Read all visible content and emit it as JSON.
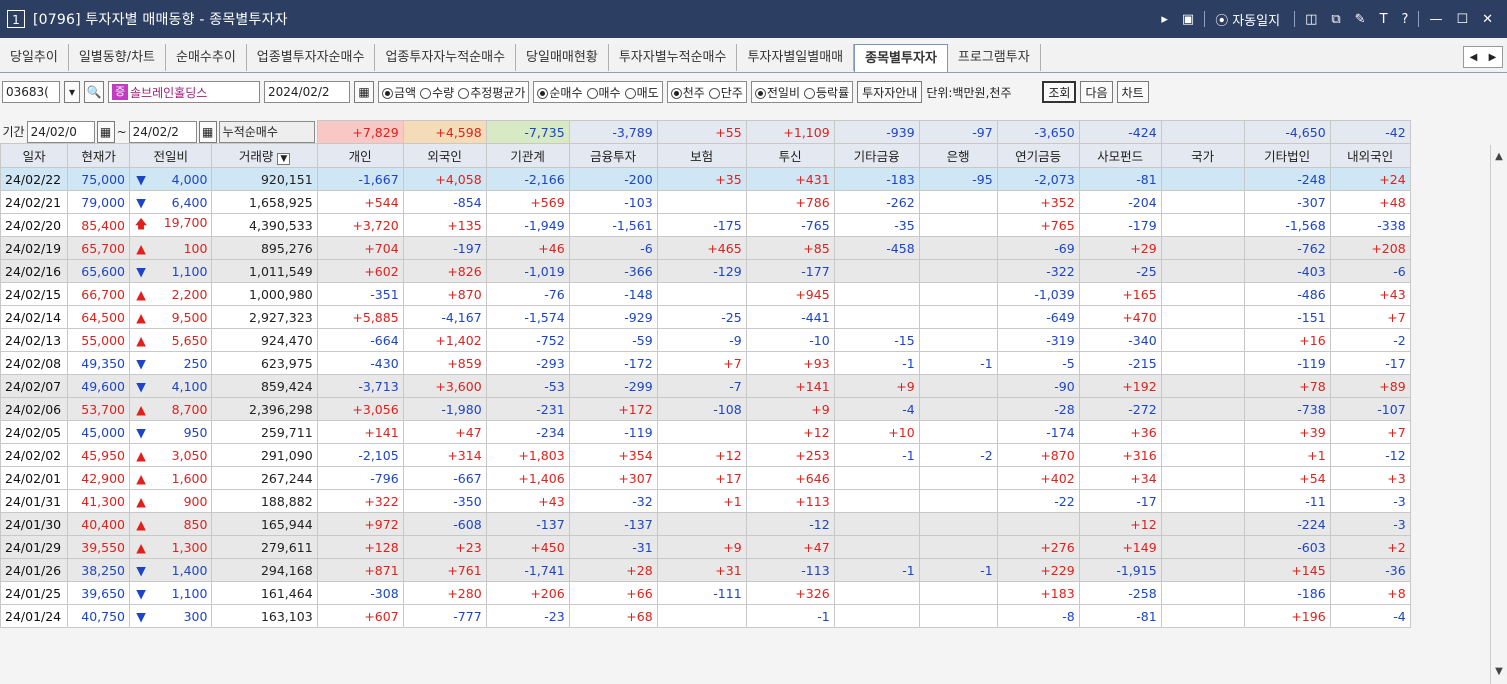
{
  "window": {
    "number": "1",
    "title": "[0796] 투자자별 매매동향 - 종목별투자자",
    "auto_label": "자동일지"
  },
  "tabs": [
    {
      "label": "당일추이",
      "active": false
    },
    {
      "label": "일별동향/차트",
      "active": false
    },
    {
      "label": "순매수추이",
      "active": false
    },
    {
      "label": "업종별투자자순매수",
      "active": false
    },
    {
      "label": "업종투자자누적순매수",
      "active": false
    },
    {
      "label": "당일매매현황",
      "active": false
    },
    {
      "label": "투자자별누적순매수",
      "active": false
    },
    {
      "label": "투자자별일별매매",
      "active": false
    },
    {
      "label": "종목별투자자",
      "active": true
    },
    {
      "label": "프로그램투자",
      "active": false
    }
  ],
  "toolbar": {
    "code": "03683(",
    "stock_badge": "증",
    "stock_name": "솔브레인홀딩스",
    "date": "2024/02/2",
    "opt_amount": "금액",
    "opt_qty": "수량",
    "opt_avg": "추정평균가",
    "opt_net": "순매수",
    "opt_buy": "매수",
    "opt_sell": "매도",
    "opt_thousand": "천주",
    "opt_single": "단주",
    "opt_prevday": "전일비",
    "opt_rate": "등락률",
    "guide": "투자자안내",
    "unit": "단위:백만원,천주",
    "query": "조회",
    "next": "다음",
    "chart": "차트"
  },
  "period": {
    "label": "기간",
    "from": "24/02/0",
    "to": "24/02/2",
    "cum_label": "누적순매수"
  },
  "summary": [
    "+7,829",
    "+4,598",
    "-7,735",
    "-3,789",
    "+55",
    "+1,109",
    "-939",
    "-97",
    "-3,650",
    "-424",
    "",
    "-4,650",
    "-42"
  ],
  "headers": [
    "일자",
    "현재가",
    "전일비",
    "거래량",
    "개인",
    "외국인",
    "기관계",
    "금융투자",
    "보험",
    "투신",
    "기타금융",
    "은행",
    "연기금등",
    "사모펀드",
    "국가",
    "기타법인",
    "내외국인"
  ],
  "rows": [
    {
      "date": "24/02/22",
      "price": "75,000",
      "dir": "down",
      "chg": "4,000",
      "vol": "920,151",
      "v": [
        "-1,667",
        "+4,058",
        "-2,166",
        "-200",
        "+35",
        "+431",
        "-183",
        "-95",
        "-2,073",
        "-81",
        "",
        "-248",
        "+24"
      ]
    },
    {
      "date": "24/02/21",
      "price": "79,000",
      "dir": "down",
      "chg": "6,400",
      "vol": "1,658,925",
      "v": [
        "+544",
        "-854",
        "+569",
        "-103",
        "",
        "+786",
        "-262",
        "",
        "+352",
        "-204",
        "",
        "-307",
        "+48"
      ]
    },
    {
      "date": "24/02/20",
      "price": "85,400",
      "dir": "limitup",
      "chg": "19,700",
      "vol": "4,390,533",
      "v": [
        "+3,720",
        "+135",
        "-1,949",
        "-1,561",
        "-175",
        "-765",
        "-35",
        "",
        "+765",
        "-179",
        "",
        "-1,568",
        "-338"
      ]
    },
    {
      "date": "24/02/19",
      "price": "65,700",
      "dir": "up",
      "chg": "100",
      "vol": "895,276",
      "v": [
        "+704",
        "-197",
        "+46",
        "-6",
        "+465",
        "+85",
        "-458",
        "",
        "-69",
        "+29",
        "",
        "-762",
        "+208"
      ]
    },
    {
      "date": "24/02/16",
      "price": "65,600",
      "dir": "down",
      "chg": "1,100",
      "vol": "1,011,549",
      "v": [
        "+602",
        "+826",
        "-1,019",
        "-366",
        "-129",
        "-177",
        "",
        "",
        "-322",
        "-25",
        "",
        "-403",
        "-6"
      ]
    },
    {
      "date": "24/02/15",
      "price": "66,700",
      "dir": "up",
      "chg": "2,200",
      "vol": "1,000,980",
      "v": [
        "-351",
        "+870",
        "-76",
        "-148",
        "",
        "+945",
        "",
        "",
        "-1,039",
        "+165",
        "",
        "-486",
        "+43"
      ]
    },
    {
      "date": "24/02/14",
      "price": "64,500",
      "dir": "up",
      "chg": "9,500",
      "vol": "2,927,323",
      "v": [
        "+5,885",
        "-4,167",
        "-1,574",
        "-929",
        "-25",
        "-441",
        "",
        "",
        "-649",
        "+470",
        "",
        "-151",
        "+7"
      ]
    },
    {
      "date": "24/02/13",
      "price": "55,000",
      "dir": "up",
      "chg": "5,650",
      "vol": "924,470",
      "v": [
        "-664",
        "+1,402",
        "-752",
        "-59",
        "-9",
        "-10",
        "-15",
        "",
        "-319",
        "-340",
        "",
        "+16",
        "-2"
      ]
    },
    {
      "date": "24/02/08",
      "price": "49,350",
      "dir": "down",
      "chg": "250",
      "vol": "623,975",
      "v": [
        "-430",
        "+859",
        "-293",
        "-172",
        "+7",
        "+93",
        "-1",
        "-1",
        "-5",
        "-215",
        "",
        "-119",
        "-17"
      ]
    },
    {
      "date": "24/02/07",
      "price": "49,600",
      "dir": "down",
      "chg": "4,100",
      "vol": "859,424",
      "v": [
        "-3,713",
        "+3,600",
        "-53",
        "-299",
        "-7",
        "+141",
        "+9",
        "",
        "-90",
        "+192",
        "",
        "+78",
        "+89"
      ]
    },
    {
      "date": "24/02/06",
      "price": "53,700",
      "dir": "up",
      "chg": "8,700",
      "vol": "2,396,298",
      "v": [
        "+3,056",
        "-1,980",
        "-231",
        "+172",
        "-108",
        "+9",
        "-4",
        "",
        "-28",
        "-272",
        "",
        "-738",
        "-107"
      ]
    },
    {
      "date": "24/02/05",
      "price": "45,000",
      "dir": "down",
      "chg": "950",
      "vol": "259,711",
      "v": [
        "+141",
        "+47",
        "-234",
        "-119",
        "",
        "+12",
        "+10",
        "",
        "-174",
        "+36",
        "",
        "+39",
        "+7"
      ]
    },
    {
      "date": "24/02/02",
      "price": "45,950",
      "dir": "up",
      "chg": "3,050",
      "vol": "291,090",
      "v": [
        "-2,105",
        "+314",
        "+1,803",
        "+354",
        "+12",
        "+253",
        "-1",
        "-2",
        "+870",
        "+316",
        "",
        "+1",
        "-12"
      ]
    },
    {
      "date": "24/02/01",
      "price": "42,900",
      "dir": "up",
      "chg": "1,600",
      "vol": "267,244",
      "v": [
        "-796",
        "-667",
        "+1,406",
        "+307",
        "+17",
        "+646",
        "",
        "",
        "+402",
        "+34",
        "",
        "+54",
        "+3"
      ]
    },
    {
      "date": "24/01/31",
      "price": "41,300",
      "dir": "up",
      "chg": "900",
      "vol": "188,882",
      "v": [
        "+322",
        "-350",
        "+43",
        "-32",
        "+1",
        "+113",
        "",
        "",
        "-22",
        "-17",
        "",
        "-11",
        "-3"
      ]
    },
    {
      "date": "24/01/30",
      "price": "40,400",
      "dir": "up",
      "chg": "850",
      "vol": "165,944",
      "v": [
        "+972",
        "-608",
        "-137",
        "-137",
        "",
        "-12",
        "",
        "",
        "",
        "+12",
        "",
        "-224",
        "-3"
      ]
    },
    {
      "date": "24/01/29",
      "price": "39,550",
      "dir": "up",
      "chg": "1,300",
      "vol": "279,611",
      "v": [
        "+128",
        "+23",
        "+450",
        "-31",
        "+9",
        "+47",
        "",
        "",
        "+276",
        "+149",
        "",
        "-603",
        "+2"
      ]
    },
    {
      "date": "24/01/26",
      "price": "38,250",
      "dir": "down",
      "chg": "1,400",
      "vol": "294,168",
      "v": [
        "+871",
        "+761",
        "-1,741",
        "+28",
        "+31",
        "-113",
        "-1",
        "-1",
        "+229",
        "-1,915",
        "",
        "+145",
        "-36"
      ]
    },
    {
      "date": "24/01/25",
      "price": "39,650",
      "dir": "down",
      "chg": "1,100",
      "vol": "161,464",
      "v": [
        "-308",
        "+280",
        "+206",
        "+66",
        "-111",
        "+326",
        "",
        "",
        "+183",
        "-258",
        "",
        "-186",
        "+8"
      ]
    },
    {
      "date": "24/01/24",
      "price": "40,750",
      "dir": "down",
      "chg": "300",
      "vol": "163,103",
      "v": [
        "+607",
        "-777",
        "-23",
        "+68",
        "",
        "-1",
        "",
        "",
        "-8",
        "-81",
        "",
        "+196",
        "-4"
      ]
    }
  ],
  "colors": {
    "up": "#e0201b",
    "down": "#1c44c8",
    "titlebar": "#2c3f62",
    "selected": "#cfe6f5"
  }
}
